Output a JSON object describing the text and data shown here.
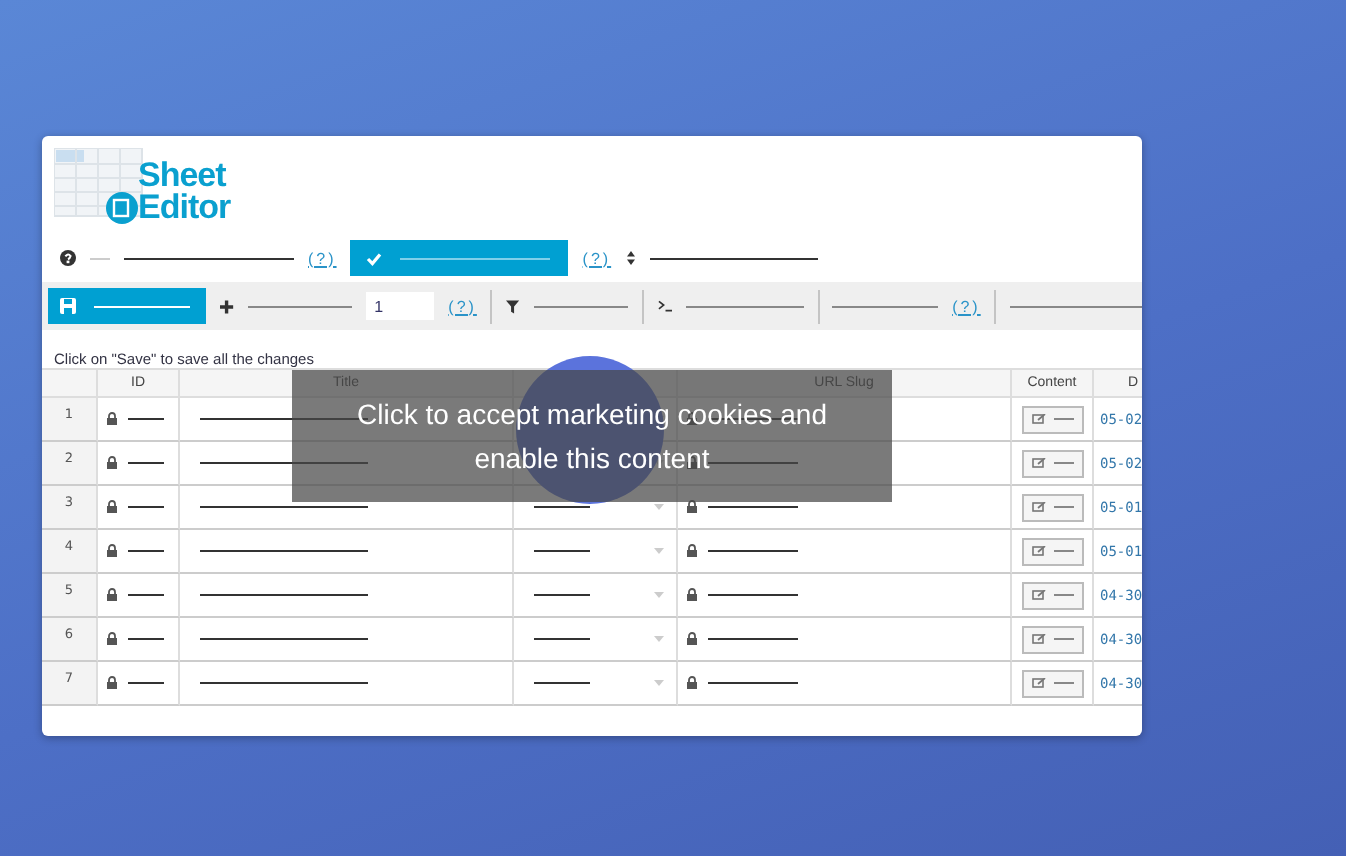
{
  "logo": {
    "line_1": "Sheet",
    "line_2": "Editor"
  },
  "toolbar_1": {
    "help_links": [
      "(?)",
      "(?)"
    ]
  },
  "toolbar_2": {
    "quantity": "1",
    "help_links": [
      "(?)",
      "(?)"
    ]
  },
  "hint": "Click on \"Save\" to save all the changes",
  "table": {
    "columns": [
      "ID",
      "Title",
      "URL Slug",
      "Content",
      "D"
    ],
    "rows": [
      {
        "number": "1",
        "date": "05-02"
      },
      {
        "number": "2",
        "date": "05-02"
      },
      {
        "number": "3",
        "date": "05-01"
      },
      {
        "number": "4",
        "date": "05-01"
      },
      {
        "number": "5",
        "date": "04-30"
      },
      {
        "number": "6",
        "date": "04-30"
      },
      {
        "number": "7",
        "date": "04-30"
      }
    ]
  },
  "cookie_notice": {
    "lines": [
      "Click to accept marketing cookies and",
      "enable this content"
    ]
  }
}
